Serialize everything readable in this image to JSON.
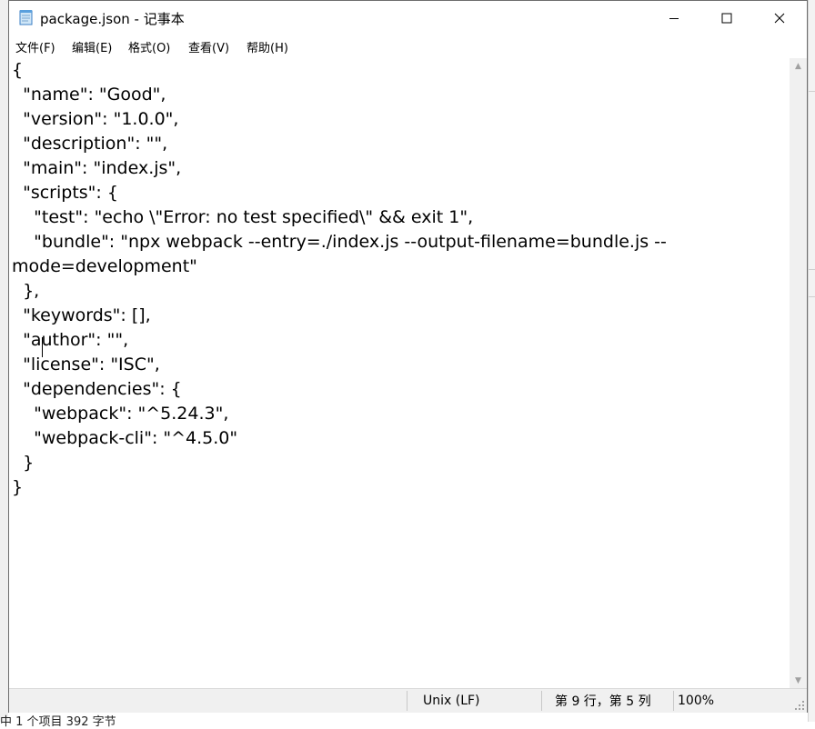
{
  "window": {
    "title": "package.json - 记事本",
    "icon": "notepad-icon",
    "controls": [
      "minimize-icon",
      "maximize-icon",
      "close-icon"
    ]
  },
  "menu": [
    {
      "label": "文件(F)",
      "key": "F"
    },
    {
      "label": "编辑(E)",
      "key": "E"
    },
    {
      "label": "格式(O)",
      "key": "O"
    },
    {
      "label": "查看(V)",
      "key": "V"
    },
    {
      "label": "帮助(H)",
      "key": "H"
    }
  ],
  "editor": {
    "content": "{\n  \"name\": \"Good\",\n  \"version\": \"1.0.0\",\n  \"description\": \"\",\n  \"main\": \"index.js\",\n  \"scripts\": {\n    \"test\": \"echo \\\"Error: no test specified\\\" && exit 1\",\n    \"bundle\": \"npx webpack --entry=./index.js --output-filename=bundle.js --\nmode=development\"\n  },\n  \"keywords\": [],\n  \"author\": \"\",\n  \"license\": \"ISC\",\n  \"dependencies\": {\n    \"webpack\": \"^5.24.3\",\n    \"webpack-cli\": \"^4.5.0\"\n  }\n}"
  },
  "status": {
    "line_ending": "Unix (LF)",
    "position": "第 9 行，第 5 列",
    "zoom": "100%"
  },
  "background": {
    "explorer_status": "中 1 个项目  392 字节"
  }
}
